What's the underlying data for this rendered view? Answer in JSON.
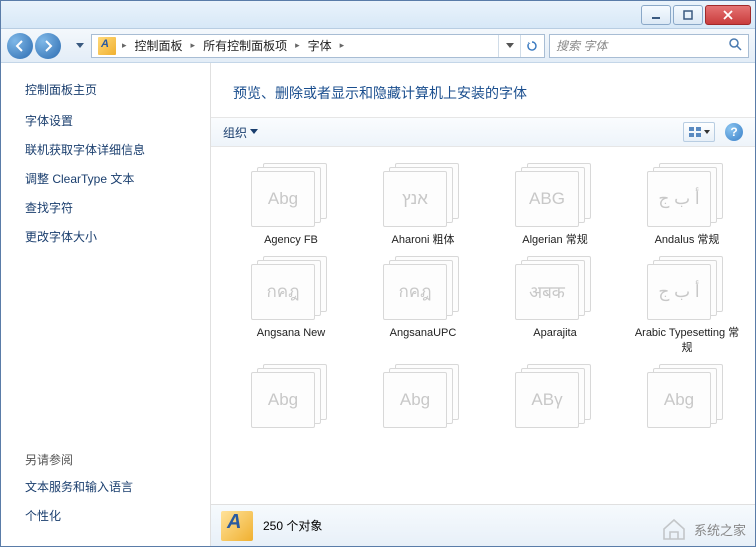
{
  "breadcrumbs": [
    "控制面板",
    "所有控制面板项",
    "字体"
  ],
  "search_placeholder": "搜索 字体",
  "sidebar": {
    "heading": "控制面板主页",
    "links": [
      "字体设置",
      "联机获取字体详细信息",
      "调整 ClearType 文本",
      "查找字符",
      "更改字体大小"
    ],
    "see_also_heading": "另请参阅",
    "see_also": [
      "文本服务和输入语言",
      "个性化"
    ]
  },
  "main": {
    "title": "预览、删除或者显示和隐藏计算机上安装的字体",
    "organize_label": "组织"
  },
  "fonts": [
    {
      "name": "Agency FB",
      "sample": "Abg"
    },
    {
      "name": "Aharoni 粗体",
      "sample": "אנץ"
    },
    {
      "name": "Algerian 常规",
      "sample": "ABG"
    },
    {
      "name": "Andalus 常规",
      "sample": "أ ب ج"
    },
    {
      "name": "Angsana New",
      "sample": "กคฎ"
    },
    {
      "name": "AngsanaUPC",
      "sample": "กคฎ"
    },
    {
      "name": "Aparajita",
      "sample": "अबक"
    },
    {
      "name": "Arabic Typesetting 常规",
      "sample": "أ ب ج"
    },
    {
      "name": "",
      "sample": "Abg"
    },
    {
      "name": "",
      "sample": "Abg"
    },
    {
      "name": "",
      "sample": "ΑΒγ"
    },
    {
      "name": "",
      "sample": "Abg"
    }
  ],
  "status": {
    "count_label": "250 个对象"
  },
  "watermark": "系统之家"
}
